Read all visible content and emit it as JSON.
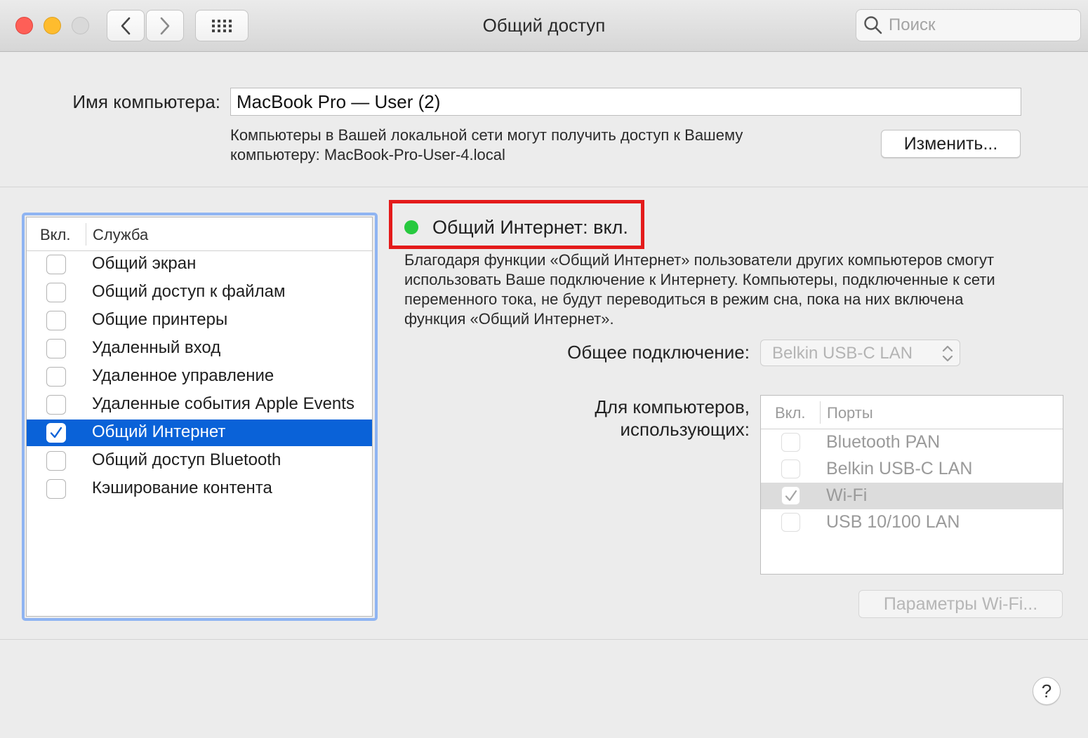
{
  "window": {
    "title": "Общий доступ",
    "search_placeholder": "Поиск"
  },
  "computer_name": {
    "label": "Имя компьютера:",
    "value": "MacBook Pro — User (2)",
    "description_line1": "Компьютеры в Вашей локальной сети могут получить доступ к Вашему",
    "description_line2": "компьютеру: MacBook-Pro-User-4.local",
    "change_button": "Изменить..."
  },
  "services": {
    "header_on": "Вкл.",
    "header_service": "Служба",
    "items": [
      {
        "label": "Общий экран",
        "checked": false
      },
      {
        "label": "Общий доступ к файлам",
        "checked": false
      },
      {
        "label": "Общие принтеры",
        "checked": false
      },
      {
        "label": "Удаленный вход",
        "checked": false
      },
      {
        "label": "Удаленное управление",
        "checked": false
      },
      {
        "label": "Удаленные события Apple Events",
        "checked": false
      },
      {
        "label": "Общий Интернет",
        "checked": true,
        "selected": true
      },
      {
        "label": "Общий доступ Bluetooth",
        "checked": false
      },
      {
        "label": "Кэширование контента",
        "checked": false
      }
    ]
  },
  "detail": {
    "status": "Общий Интернет: вкл.",
    "status_color": "#27c93f",
    "highlight_color": "#e41b1b",
    "description_line1": "Благодаря функции «Общий Интернет» пользователи других компьютеров смогут",
    "description_line2": "использовать Ваше подключение к Интернету. Компьютеры, подключенные к сети",
    "description_line3": "переменного тока, не будут переводиться в режим сна, пока на них включена",
    "description_line4": "функция «Общий Интернет».",
    "shared_connection_label": "Общее подключение:",
    "shared_connection_value": "Belkin USB-C LAN",
    "for_computers_label_line1": "Для компьютеров,",
    "for_computers_label_line2": "использующих:",
    "ports_header_on": "Вкл.",
    "ports_header_ports": "Порты",
    "ports": [
      {
        "label": "Bluetooth PAN",
        "checked": false
      },
      {
        "label": "Belkin USB-C LAN",
        "checked": false
      },
      {
        "label": "Wi-Fi",
        "checked": true,
        "selected": true
      },
      {
        "label": "USB 10/100 LAN",
        "checked": false
      }
    ],
    "wifi_options_button": "Параметры Wi-Fi..."
  },
  "help_button": "?",
  "colors": {
    "selection": "#0a62d8",
    "focus_ring": "#8fb4f2"
  }
}
